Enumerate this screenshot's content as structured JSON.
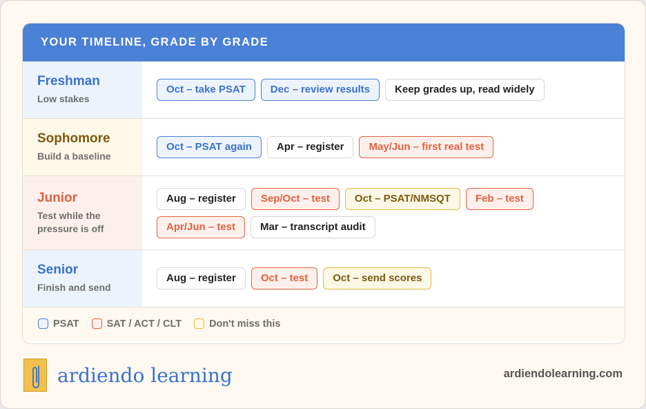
{
  "title": "YOUR TIMELINE, GRADE BY GRADE",
  "colors": {
    "header": "#4a80d6",
    "psat": "#4a80d6",
    "sat_act_clt": "#e2613f",
    "dont_miss": "#e5b83a"
  },
  "rows": [
    {
      "grade": "Freshman",
      "subtitle": "Low stakes",
      "items": [
        {
          "text": "Oct – take PSAT",
          "kind": "psat"
        },
        {
          "text": "Dec – review results",
          "kind": "psat"
        },
        {
          "text": "Keep grades up, read widely",
          "kind": "plain"
        }
      ]
    },
    {
      "grade": "Sophomore",
      "subtitle": "Build a baseline",
      "items": [
        {
          "text": "Oct – PSAT again",
          "kind": "psat"
        },
        {
          "text": "Apr – register",
          "kind": "plain"
        },
        {
          "text": "May/Jun – first real test",
          "kind": "sat"
        }
      ]
    },
    {
      "grade": "Junior",
      "subtitle": "Test while the pressure is off",
      "items": [
        {
          "text": "Aug – register",
          "kind": "plain"
        },
        {
          "text": "Sep/Oct – test",
          "kind": "sat"
        },
        {
          "text": "Oct – PSAT/NMSQT",
          "kind": "miss"
        },
        {
          "text": "Feb – test",
          "kind": "sat"
        },
        {
          "text": "Apr/Jun – test",
          "kind": "sat"
        },
        {
          "text": "Mar – transcript audit",
          "kind": "plain"
        }
      ]
    },
    {
      "grade": "Senior",
      "subtitle": "Finish and send",
      "items": [
        {
          "text": "Aug – register",
          "kind": "plain"
        },
        {
          "text": "Oct – test",
          "kind": "sat"
        },
        {
          "text": "Oct – send scores",
          "kind": "miss"
        }
      ]
    }
  ],
  "legend": [
    {
      "label": "PSAT",
      "kind": "psat"
    },
    {
      "label": "SAT / ACT / CLT",
      "kind": "sat"
    },
    {
      "label": "Don't miss this",
      "kind": "miss"
    }
  ],
  "footer": {
    "brand": "ardiendo learning",
    "logo_icon": "paperclip-logo-icon",
    "website": "ardiendolearning.com"
  }
}
